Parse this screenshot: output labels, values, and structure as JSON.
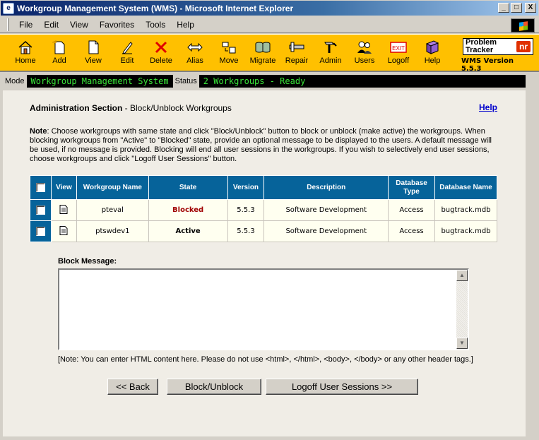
{
  "window": {
    "title": "Workgroup Management System (WMS) - Microsoft Internet Explorer",
    "minimize": "_",
    "maximize": "□",
    "close": "X"
  },
  "menubar": {
    "items": [
      "File",
      "Edit",
      "View",
      "Favorites",
      "Tools",
      "Help"
    ]
  },
  "toolbar": {
    "buttons": [
      {
        "label": "Home",
        "icon": "home-icon"
      },
      {
        "label": "Add",
        "icon": "add-icon"
      },
      {
        "label": "View",
        "icon": "view-icon"
      },
      {
        "label": "Edit",
        "icon": "edit-icon"
      },
      {
        "label": "Delete",
        "icon": "delete-icon"
      },
      {
        "label": "Alias",
        "icon": "alias-icon"
      },
      {
        "label": "Move",
        "icon": "move-icon"
      },
      {
        "label": "Migrate",
        "icon": "migrate-icon"
      },
      {
        "label": "Repair",
        "icon": "repair-icon"
      },
      {
        "label": "Admin",
        "icon": "admin-icon"
      },
      {
        "label": "Users",
        "icon": "users-icon"
      },
      {
        "label": "Logoff",
        "icon": "logoff-icon",
        "icon_text": "EXIT"
      },
      {
        "label": "Help",
        "icon": "help-icon"
      }
    ]
  },
  "brand": {
    "line1": "Problem",
    "line2": "Tracker",
    "mark": "nr",
    "version": "WMS Version 5.5.3"
  },
  "status": {
    "mode_label": "Mode",
    "mode_value": "Workgroup Management System",
    "status_label": "Status",
    "status_value": "2 Workgroups - Ready"
  },
  "page": {
    "section": "Administration Section",
    "subtitle": " - Block/Unblock Workgroups",
    "help": "Help",
    "note_label": "Note",
    "note_text": ": Choose workgroups with same state and click \"Block/Unblock\" button to block or unblock (make active) the workgroups. When blocking workgroups from \"Active\" to \"Blocked\" state, provide an optional message to be displayed to the users. A default message will be used, if no message is provided. Blocking will end all user sessions in the workgroups. If you wish to selectively end user sessions, choose workgroups and click \"Logoff User Sessions\" button."
  },
  "table": {
    "headers": [
      "View",
      "Workgroup Name",
      "State",
      "Version",
      "Description",
      "Database Type",
      "Database Name"
    ],
    "rows": [
      {
        "name": "pteval",
        "state": "Blocked",
        "version": "5.5.3",
        "description": "Software Development",
        "db_type": "Access",
        "db_name": "bugtrack.mdb"
      },
      {
        "name": "ptswdev1",
        "state": "Active",
        "version": "5.5.3",
        "description": "Software Development",
        "db_type": "Access",
        "db_name": "bugtrack.mdb"
      }
    ]
  },
  "block_message": {
    "label": "Block Message:",
    "value": "",
    "html_note": "[Note: You can enter HTML content here. Please do not use <html>, </html>, <body>, </body> or any other header tags.]"
  },
  "buttons": {
    "back": "<< Back",
    "block": "Block/Unblock",
    "logoff": "Logoff User Sessions >>"
  },
  "colors": {
    "toolbar_bg": "#ffc000",
    "table_header": "#06639a",
    "status_text": "#39e639",
    "blocked": "#a00000",
    "link": "#0000cc"
  }
}
